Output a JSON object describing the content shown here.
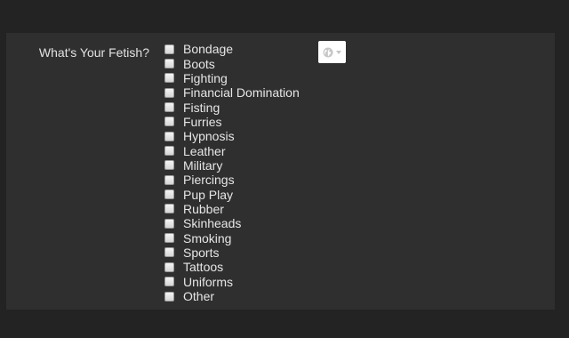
{
  "form": {
    "label": "What's Your Fetish?",
    "options": [
      {
        "label": "Bondage",
        "checked": false
      },
      {
        "label": "Boots",
        "checked": false
      },
      {
        "label": "Fighting",
        "checked": false
      },
      {
        "label": "Financial Domination",
        "checked": false
      },
      {
        "label": "Fisting",
        "checked": false
      },
      {
        "label": "Furries",
        "checked": false
      },
      {
        "label": "Hypnosis",
        "checked": false
      },
      {
        "label": "Leather",
        "checked": false
      },
      {
        "label": "Military",
        "checked": false
      },
      {
        "label": "Piercings",
        "checked": false
      },
      {
        "label": "Pup Play",
        "checked": false
      },
      {
        "label": "Rubber",
        "checked": false
      },
      {
        "label": "Skinheads",
        "checked": false
      },
      {
        "label": "Smoking",
        "checked": false
      },
      {
        "label": "Sports",
        "checked": false
      },
      {
        "label": "Tattoos",
        "checked": false
      },
      {
        "label": "Uniforms",
        "checked": false
      },
      {
        "label": "Other",
        "checked": false
      }
    ]
  },
  "visibility": {
    "icon": "globe-icon",
    "dropdown_icon": "chevron-down-icon"
  },
  "colors": {
    "page_background": "#232323",
    "panel_background": "#2f2f2f",
    "text": "#e6e6e6"
  }
}
